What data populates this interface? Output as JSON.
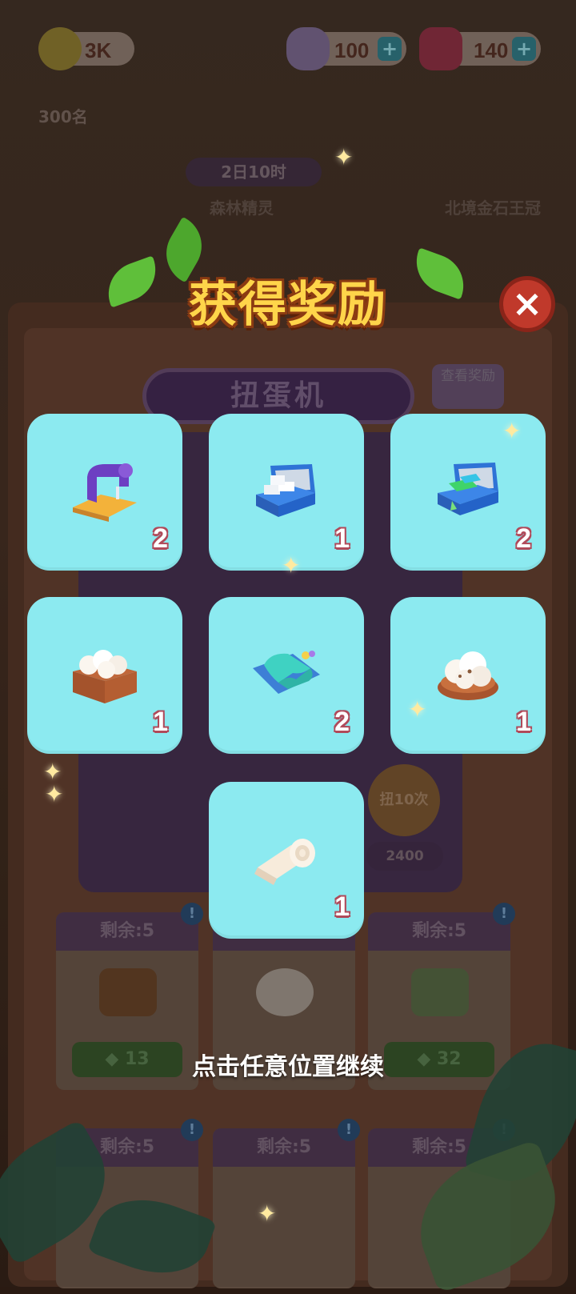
{
  "hud": {
    "coins": "3K",
    "rank": "300名",
    "gems_feather": "100",
    "gems_ruby": "140",
    "plus": "+"
  },
  "event": {
    "timer": "2日10时",
    "name_left": "森林精灵",
    "name_right": "北境金石王冠"
  },
  "machine": {
    "title": "扭蛋机",
    "view_rewards": "查看奖励",
    "spin10": "扭10次",
    "price": "2400"
  },
  "shop": {
    "remaining_label": "剩余:5",
    "prices": [
      "13",
      "",
      "32"
    ],
    "row2": [
      "剩余:5",
      "剩余:5",
      "剩余:5"
    ]
  },
  "overlay": {
    "title": "获得奖励",
    "close": "×",
    "continue_text": "点击任意位置继续",
    "rewards": [
      {
        "icon": "sewing-machine-icon",
        "qty": "2"
      },
      {
        "icon": "marble-toolbox-icon",
        "qty": "1"
      },
      {
        "icon": "gem-toolbox-icon",
        "qty": "2"
      },
      {
        "icon": "cotton-crate-icon",
        "qty": "1"
      },
      {
        "icon": "fabric-cloth-icon",
        "qty": "2"
      },
      {
        "icon": "cotton-bowl-icon",
        "qty": "1"
      },
      {
        "icon": "towel-roll-icon",
        "qty": "1"
      }
    ]
  },
  "colors": {
    "card_bg": "#8ceaf0",
    "title_fill": "#ffd54a",
    "title_stroke": "#8b3b12",
    "qty_stroke": "#b04a5a",
    "close_bg": "#c0392b"
  }
}
